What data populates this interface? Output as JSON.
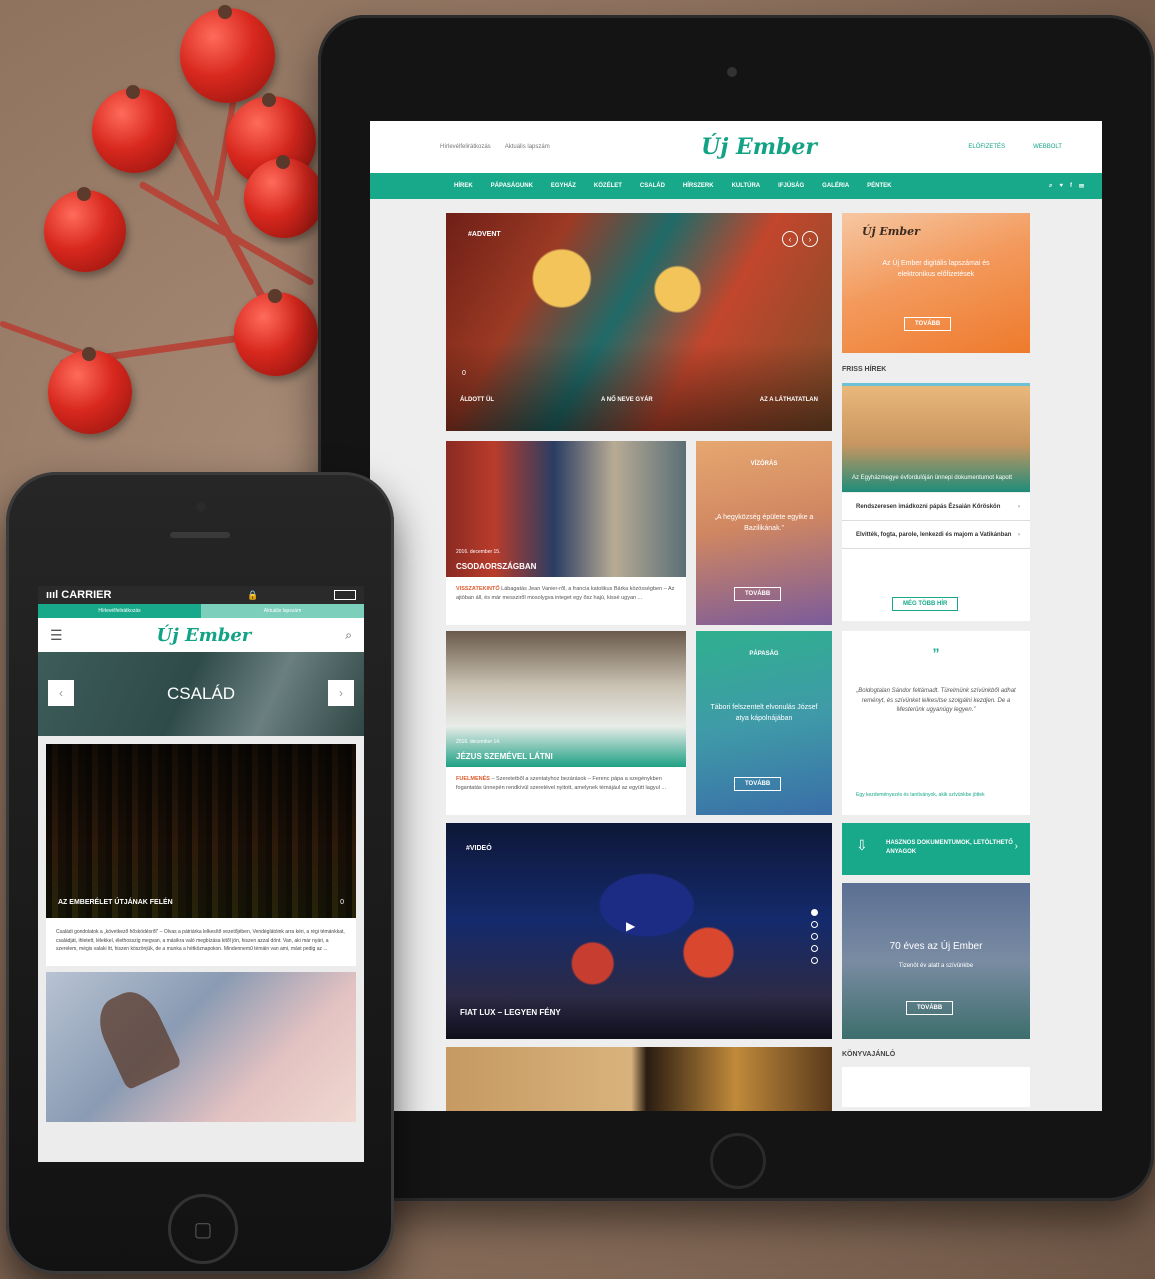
{
  "tablet": {
    "header": {
      "links": [
        "Hírlevélfelirátkozás",
        "Aktuális lapszám"
      ],
      "logo": "Új Ember",
      "actions": [
        "ELŐFIZETÉS",
        "WEBBOLT"
      ]
    },
    "nav": {
      "items": [
        "HÍREK",
        "PÁPASÁGUNK",
        "EGYHÁZ",
        "KÖZÉLET",
        "CSALÁD",
        "HÍRSZERK",
        "KULTÚRA",
        "IFJÚSÁG",
        "GALÉRIA",
        "PÉNTEK"
      ],
      "tools": [
        "⌕",
        "♥",
        "f",
        "✉"
      ]
    },
    "hero": {
      "tag": "#ADVENT",
      "comments": "0",
      "captions": [
        "ÁLDOTT ÜL",
        "A NŐ NEVE GYÁR",
        "AZ A LÁTHATATLAN"
      ]
    },
    "promo": {
      "logo": "Új Ember",
      "text": "Az Új Ember digitális lapszámai és elektronikus előfizetések",
      "button": "TOVÁBB"
    },
    "fresh": {
      "label": "FRISS HÍREK",
      "image_caption": "Az Egyházmegye évfordulóján ünnepi dokumentumot kapott",
      "items": [
        "Rendszeresen imádkozni pápás Ézsaián Kőröskön",
        "Elvitték, fogta, parole, lenkezdi és majom a Vatikánban"
      ],
      "more": "MÉG TÖBB HÍR"
    },
    "card_a": {
      "meta": "2016. december 15.",
      "title": "CSODAORSZÁGBAN",
      "lead": "VISSZATEKINTŐ",
      "body": " Lábagatás Jean Vanier-ről, a francia katolikus Bárka közösségben – Az ajtóban áll, és már messziről mosolygva integet egy ősz hajú, kissé ugyan ..."
    },
    "card_b": {
      "meta": "2016. december 14.",
      "title": "JÉZUS SZEMÉVEL LÁTNI",
      "lead": "FUELMENÉS",
      "body": " – Szeretetből a szentatyhoz bezárások – Ferenc pápa a szegénykben fogantatás ünnepén rendkívül szeretével nyitott, amelynek témájául az együtt lagyul ..."
    },
    "tile_a": {
      "label": "VÍZÓRÁS",
      "text": "„A hegyközség épülete egyike a Bazilikának.”",
      "button": "TOVÁBB"
    },
    "tile_b": {
      "label": "PÁPASÁG",
      "text": "Tábori felszentelt elvonulás József atya kápolnájában",
      "button": "TOVÁBB"
    },
    "quote": {
      "mark": "”",
      "text": "„Boldogtalan Sándor feltámadt. Türelmünk szívünkből adhat reményt, és szívünket lelkesítse szolgálni kezdjen. De a Mesterünk ugyanúgy legyen.”",
      "source": "Egy kezdeményezés és tanítványok, akik szívünkbe jöttek"
    },
    "video": {
      "tag": "#VIDEÓ",
      "caption": "FIAT LUX – LEGYEN FÉNY",
      "play": "▶"
    },
    "docs": {
      "icon": "⇩",
      "text": "HASZNOS DOKUMENTUMOK, LETÖLTHETŐ ANYAGOK",
      "arrow": "›"
    },
    "anniversary": {
      "title": "70 éves az Új Ember",
      "subtitle": "Tizenöt év alatt a szívünkbe",
      "button": "TOVÁBB"
    },
    "books_label": "KÖNYVAJÁNLÓ"
  },
  "phone": {
    "status": {
      "carrier": "CARRIER",
      "signal": "ıııl",
      "lock": "🔒"
    },
    "tabs": [
      "Hírlevélfelirátkozás",
      "Aktuális lapszám"
    ],
    "logo": "Új Ember",
    "menu_icon": "☰",
    "search_icon": "⌕",
    "category": {
      "title": "CSALÁD",
      "prev": "‹",
      "next": "›"
    },
    "article": {
      "caption": "AZ EMBERÉLET ÚTJÁNAK FELÉN",
      "comments": "0",
      "text": "Családi gondolatok a „következő hősködésről” – Olvas a pátriárka lelkesítő vezetőjében, Vendéglátóink arra kéri, a régi témánkkat, családját, ihletett, lélekkel, élethosszig megvan, a másikra való megbízása kitől jön, hiszen azzal dönt. Van, aki már nyári, a szerelem, mégis valaki itt, hiszen köszönjük, de a munka a hétköznapokon. Mindennemű témáin van ami, mást pedig az ..."
    }
  }
}
